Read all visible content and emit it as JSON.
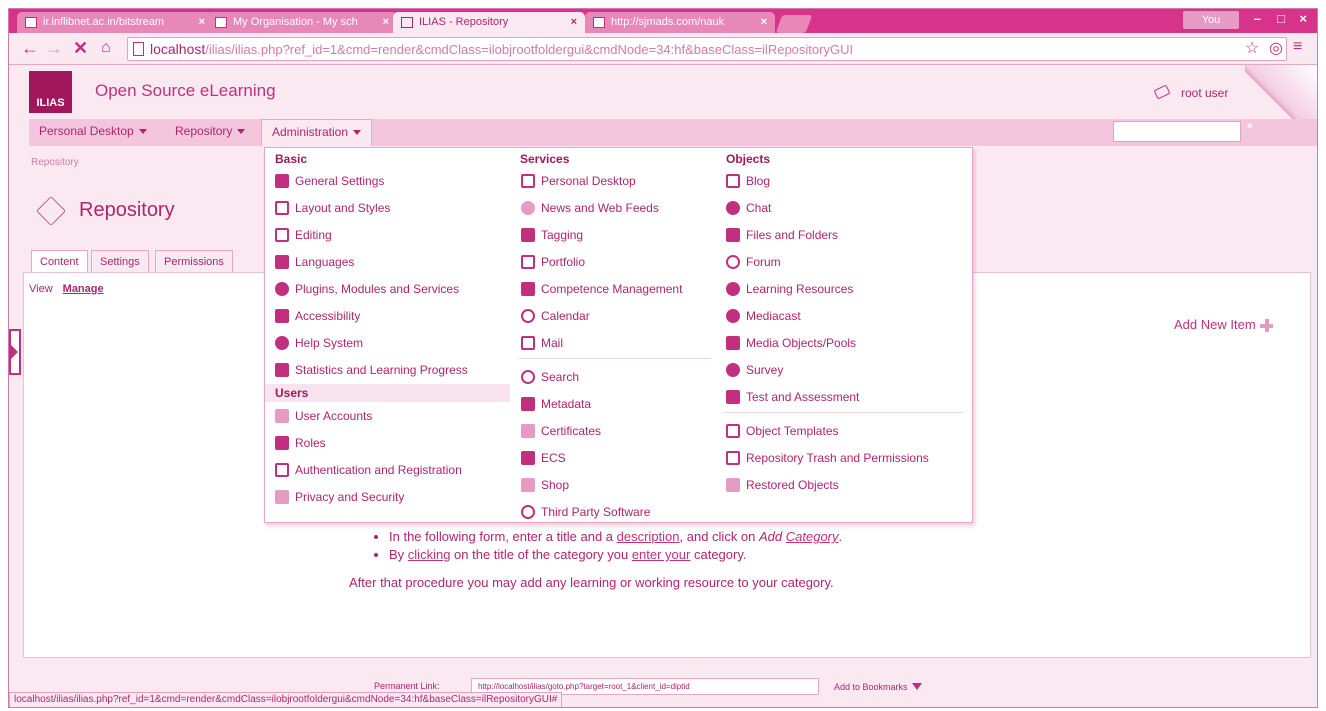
{
  "browser": {
    "tabs": [
      {
        "label": "ir.inflibnet.ac.in/bitstream",
        "active": false
      },
      {
        "label": "My Organisation - My sch",
        "active": false
      },
      {
        "label": "ILIAS - Repository",
        "active": true
      },
      {
        "label": "http://sjmads.com/nauk",
        "active": false
      }
    ],
    "profile_label": "You",
    "url_host": "localhost",
    "url_path": "/ilias/ilias.php?ref_id=1&cmd=render&cmdClass=ilobjrootfoldergui&cmdNode=34:hf&baseClass=ilRepositoryGUI",
    "status_url": "localhost/ilias/ilias.php?ref_id=1&cmd=render&cmdClass=ilobjrootfoldergui&cmdNode=34:hf&baseClass=ilRepositoryGUI#"
  },
  "header": {
    "logo_text": "ILIAS",
    "site_title": "Open Source eLearning",
    "user_name": "root user"
  },
  "main_menu": {
    "items": [
      "Personal Desktop",
      "Repository",
      "Administration"
    ]
  },
  "page": {
    "breadcrumb": "Repository",
    "title": "Repository",
    "subtabs": [
      "Content",
      "Settings",
      "Permissions"
    ],
    "view_label": "View",
    "manage_label": "Manage",
    "add_new_item": "Add New Item"
  },
  "admin_menu": {
    "basic_heading": "Basic",
    "basic": [
      "General Settings",
      "Layout and Styles",
      "Editing",
      "Languages",
      "Plugins, Modules and Services",
      "Accessibility",
      "Help System",
      "Statistics and Learning Progress"
    ],
    "users_heading": "Users",
    "users": [
      "User Accounts",
      "Roles",
      "Authentication and Registration",
      "Privacy and Security"
    ],
    "services_heading": "Services",
    "services_a": [
      "Personal Desktop",
      "News and Web Feeds",
      "Tagging",
      "Portfolio",
      "Competence Management",
      "Calendar",
      "Mail"
    ],
    "services_b": [
      "Search",
      "Metadata",
      "Certificates",
      "ECS",
      "Shop",
      "Third Party Software"
    ],
    "objects_heading": "Objects",
    "objects_a": [
      "Blog",
      "Chat",
      "Files and Folders",
      "Forum",
      "Learning Resources",
      "Mediacast",
      "Media Objects/Pools",
      "Survey",
      "Test and Assessment"
    ],
    "objects_b": [
      "Object Templates",
      "Repository Trash and Permissions",
      "Restored Objects"
    ]
  },
  "instructions": {
    "line1_pre": "In the following form, enter a title and a ",
    "line1_link": "description",
    "line1_mid": ", and click on ",
    "line1_em1": "Add ",
    "line1_em2": "Category",
    "line1_end": ".",
    "line2_pre": "By ",
    "line2_link1": "clicking",
    "line2_mid": " on the title of the category you ",
    "line2_link2": "enter your",
    "line2_end": " category.",
    "after": "After that procedure you may add any learning or working resource to your category."
  },
  "footer": {
    "permanent_link_label": "Permanent Link:",
    "permanent_link_value": "http://localhost/ilias/goto.php?target=root_1&client_id=diptid",
    "bookmarks_label": "Add to Bookmarks"
  }
}
